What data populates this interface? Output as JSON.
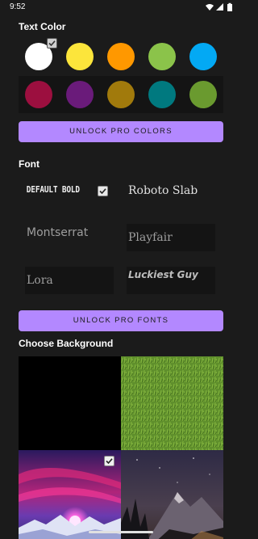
{
  "status": {
    "time": "9:52"
  },
  "text_color": {
    "title": "Text Color",
    "free_colors": [
      "#ffffff",
      "#fce53b",
      "#ff9800",
      "#8bc34a",
      "#03a9f4"
    ],
    "pro_colors": [
      "#9c0f3f",
      "#6a1b7a",
      "#a17a0c",
      "#00797f",
      "#6a9a2f"
    ],
    "selected_color": "#ffffff",
    "unlock_label": "UNLOCK PRO COLORS"
  },
  "font": {
    "title": "Font",
    "options": {
      "default_bold": "DEFAULT BOLD",
      "roboto_slab": "Roboto Slab",
      "montserrat": "Montserrat",
      "playfair": "Playfair",
      "lora": "Lora",
      "luckiest_guy": "Luckiest Guy"
    },
    "selected": "DEFAULT BOLD",
    "unlock_label": "UNLOCK PRO FONTS"
  },
  "background": {
    "title": "Choose Background",
    "tiles": [
      "black",
      "grass",
      "neon-mountain",
      "night-mountain"
    ],
    "selected": "neon-mountain"
  },
  "colors": {
    "app_bg": "#1b1b1b",
    "locked_bg": "#141414",
    "accent": "#b388ff"
  }
}
